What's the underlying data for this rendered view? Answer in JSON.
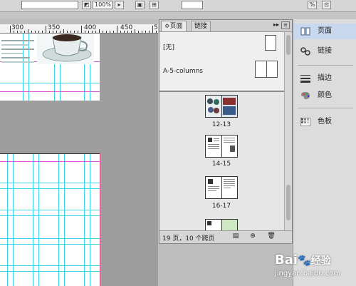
{
  "toolbar": {
    "zoom_value": "100%",
    "percent_symbol": "%"
  },
  "ruler": {
    "numbers": [
      "300",
      "350",
      "400",
      "450",
      "5"
    ]
  },
  "pages_panel": {
    "tabs": [
      {
        "label": "页面",
        "active": true
      },
      {
        "label": "链接",
        "active": false
      }
    ],
    "tab_arrow": "≎",
    "menu_arrows": "▸▸",
    "masters": [
      {
        "label": "[无]"
      },
      {
        "label": "A-5-columns"
      }
    ],
    "spreads": [
      {
        "label": "12-13"
      },
      {
        "label": "14-15"
      },
      {
        "label": "16-17"
      },
      {
        "label": ""
      }
    ],
    "status": "19 页，10 个跨页"
  },
  "dock": {
    "items": [
      {
        "label": "页面",
        "icon": "pages-icon",
        "active": true
      },
      {
        "label": "链接",
        "icon": "links-icon",
        "active": false
      },
      {
        "label": "描边",
        "icon": "stroke-icon",
        "active": false
      },
      {
        "label": "颜色",
        "icon": "color-icon",
        "active": false
      },
      {
        "label": "色板",
        "icon": "swatches-icon",
        "active": false
      }
    ]
  },
  "watermark": {
    "brand": "Bai",
    "brand_tail": "经验",
    "url": "jingyan.baidu.com"
  },
  "colors": {
    "guide": "#35d4e6",
    "margin": "#d65ad6",
    "panel_bg": "#e8e8e8",
    "dock_active": "#c9d8ee"
  }
}
